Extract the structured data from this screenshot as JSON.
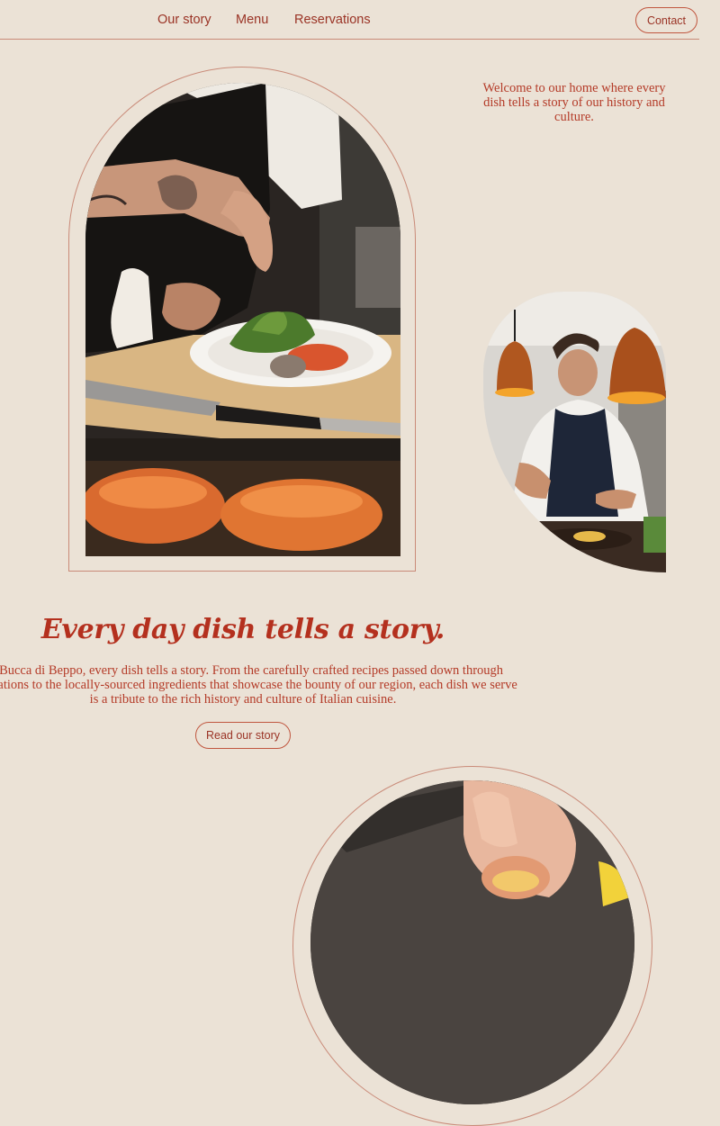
{
  "nav": {
    "links": [
      "Our story",
      "Menu",
      "Reservations"
    ],
    "contact_label": "Contact"
  },
  "intro": {
    "text": "Welcome to our home where every dish tells a story of our history and culture."
  },
  "story": {
    "headline": "Every day dish tells a story.",
    "body": "At Bucca di Beppo, every dish tells a story. From the carefully crafted recipes passed down through generations to the locally-sourced ingredients that showcase the bounty of our region, each dish we serve is a tribute to the rich history and culture of Italian cuisine.",
    "button_label": "Read our story"
  },
  "theme": {
    "background": "#ebe2d6",
    "accent": "#b4301e",
    "line": "#c98a78"
  }
}
